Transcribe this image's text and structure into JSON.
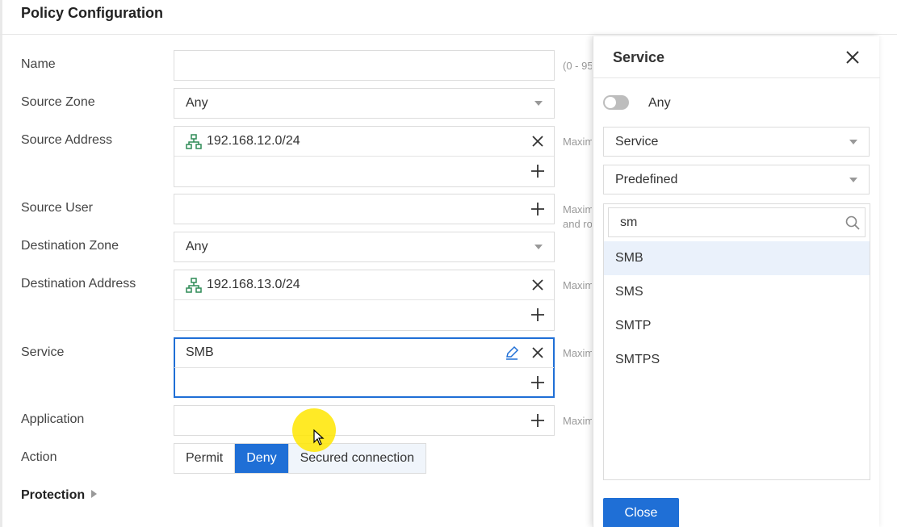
{
  "page": {
    "title": "Policy Configuration"
  },
  "form": {
    "name": {
      "label": "Name",
      "value": "",
      "hint": "(0 - 95"
    },
    "source_zone": {
      "label": "Source Zone",
      "value": "Any"
    },
    "source_address": {
      "label": "Source Address",
      "entries": [
        "192.168.12.0/24"
      ],
      "hint": "Maxim"
    },
    "source_user": {
      "label": "Source User",
      "hint_line1": "Maxim",
      "hint_line2": "and ro"
    },
    "destination_zone": {
      "label": "Destination Zone",
      "value": "Any"
    },
    "destination_address": {
      "label": "Destination Address",
      "entries": [
        "192.168.13.0/24"
      ],
      "hint": "Maxim"
    },
    "service": {
      "label": "Service",
      "entries": [
        "SMB"
      ],
      "hint": "Maxim"
    },
    "application": {
      "label": "Application",
      "hint": "Maxim"
    },
    "action": {
      "label": "Action",
      "options": [
        "Permit",
        "Deny",
        "Secured connection"
      ],
      "selected": "Deny"
    },
    "protection": {
      "label": "Protection"
    }
  },
  "panel": {
    "title": "Service",
    "any_toggle": {
      "label": "Any",
      "on": false
    },
    "type_select": "Service",
    "category_select": "Predefined",
    "search": {
      "value": "sm"
    },
    "options": [
      "SMB",
      "SMS",
      "SMTP",
      "SMTPS"
    ],
    "highlighted": "SMB",
    "close_label": "Close"
  },
  "colors": {
    "accent": "#1f6fd6",
    "highlight_row": "#eaf1fb",
    "cursor_highlight": "#ffe600"
  }
}
